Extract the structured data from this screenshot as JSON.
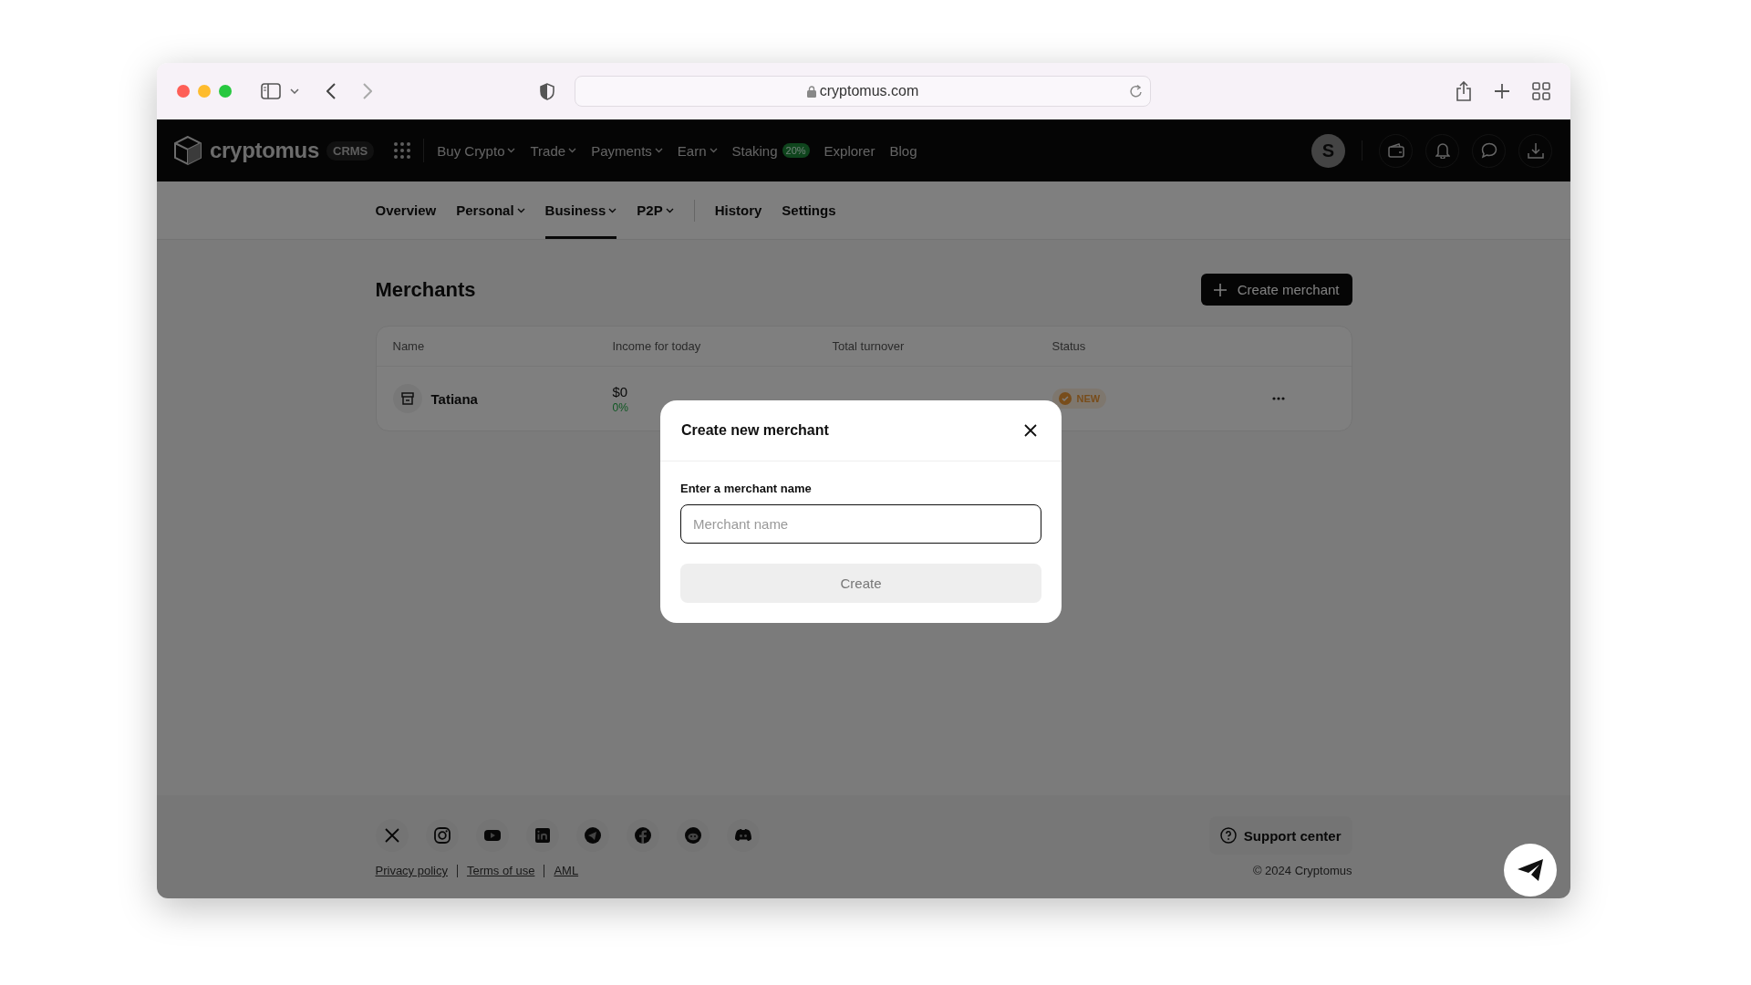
{
  "browser": {
    "url": "cryptomus.com"
  },
  "nav": {
    "logo": "cryptomus",
    "logo_badge": "CRMS",
    "items": [
      {
        "label": "Buy Crypto",
        "dropdown": true
      },
      {
        "label": "Trade",
        "dropdown": true
      },
      {
        "label": "Payments",
        "dropdown": true
      },
      {
        "label": "Earn",
        "dropdown": true
      },
      {
        "label": "Staking",
        "dropdown": false,
        "badge": "20%"
      },
      {
        "label": "Explorer",
        "dropdown": false
      },
      {
        "label": "Blog",
        "dropdown": false
      }
    ],
    "avatar": "S"
  },
  "subnav": {
    "tabs": [
      {
        "label": "Overview",
        "dropdown": false,
        "selected": false
      },
      {
        "label": "Personal",
        "dropdown": true,
        "selected": false
      },
      {
        "label": "Business",
        "dropdown": true,
        "selected": true
      },
      {
        "label": "P2P",
        "dropdown": true,
        "selected": false
      }
    ],
    "links": [
      {
        "label": "History",
        "selected": false
      },
      {
        "label": "Settings",
        "selected": false
      }
    ]
  },
  "page": {
    "title": "Merchants",
    "create_button": "Create merchant"
  },
  "table": {
    "columns": [
      "Name",
      "Income for today",
      "Total turnover",
      "Status"
    ],
    "rows": [
      {
        "name": "Tatiana",
        "income": "$0",
        "income_change": "0%",
        "status": "NEW"
      }
    ]
  },
  "modal": {
    "title": "Create new merchant",
    "field_label": "Enter a merchant name",
    "placeholder": "Merchant name",
    "button": "Create",
    "button_disabled": true
  },
  "footer": {
    "support": "Support center",
    "links": [
      "Privacy policy",
      "Terms of use",
      "AML"
    ],
    "copyright": "© 2024 Cryptomus"
  }
}
